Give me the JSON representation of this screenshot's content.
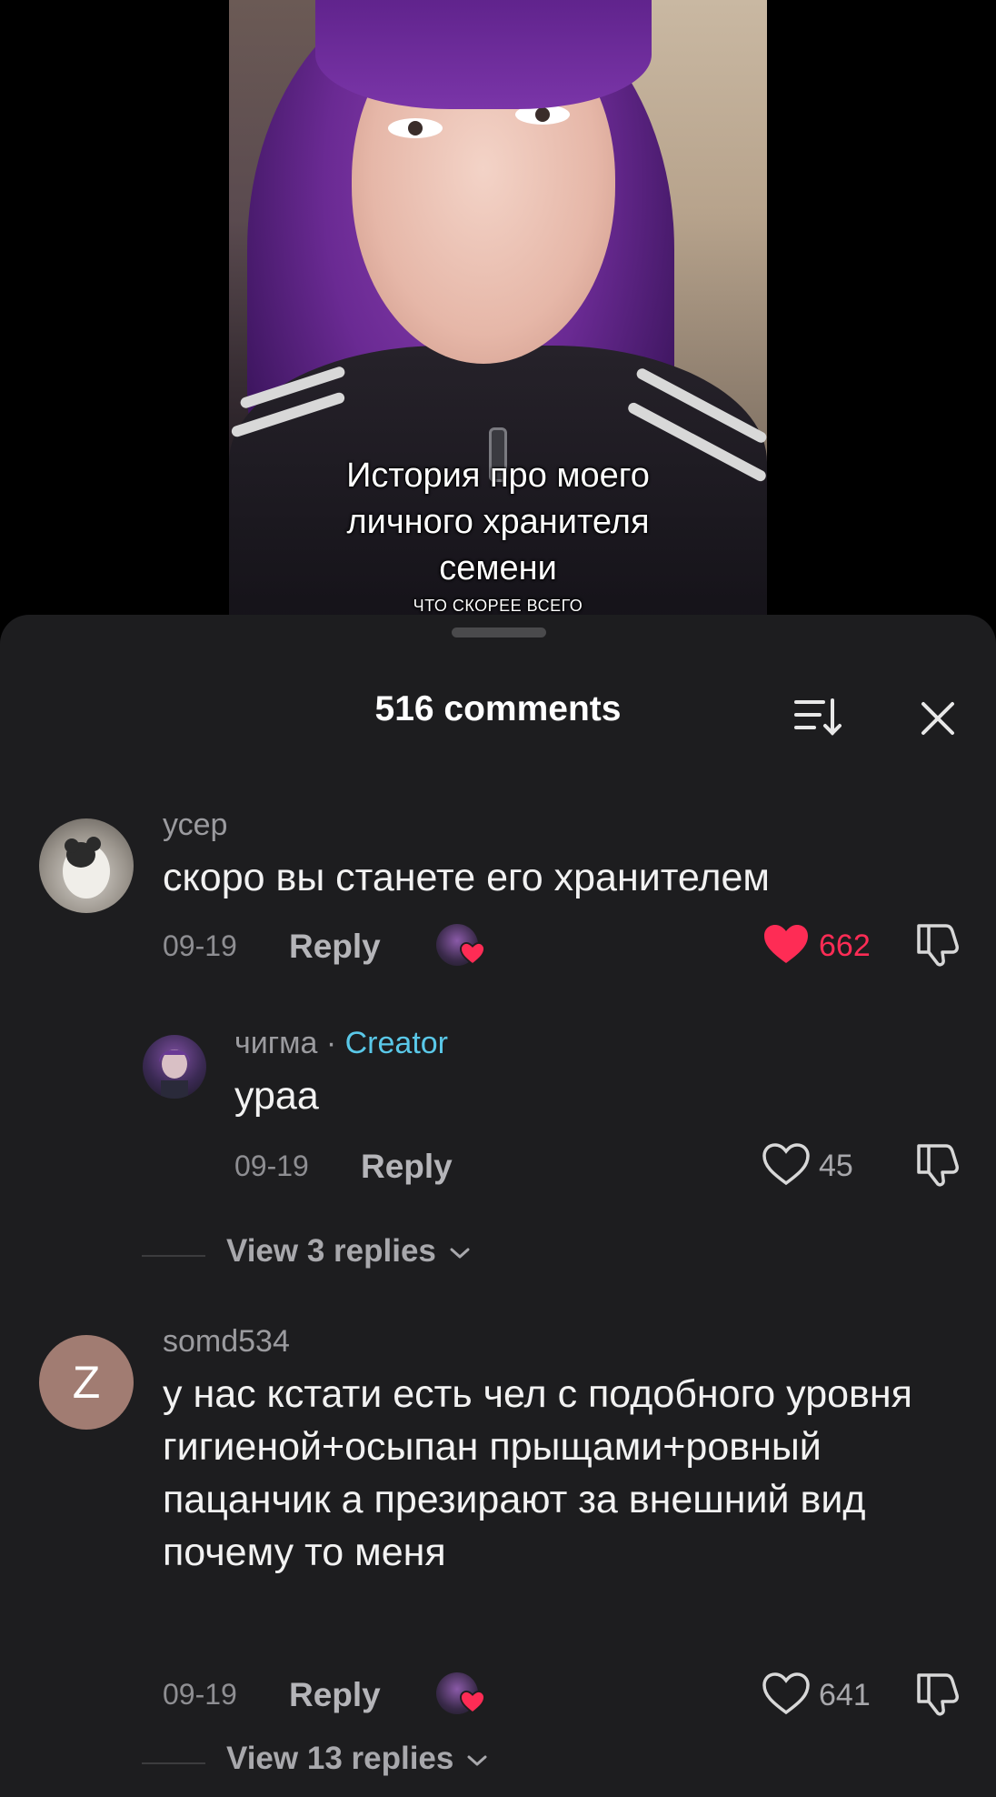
{
  "video": {
    "caption_main": "История про моего личного хранителя семени",
    "caption_sub": "ЧТО СКОРЕЕ ВСЕГО"
  },
  "header": {
    "title": "516 comments",
    "sort_icon": "sort-icon",
    "close_icon": "close-icon"
  },
  "comments": [
    {
      "username": "усер",
      "text": "скоро вы станете его хранителем",
      "date": "09-19",
      "reply_label": "Reply",
      "likes": "662",
      "liked": true,
      "like_color": "#fe2c55"
    },
    {
      "username": "чигма",
      "separator": " · ",
      "badge": "Creator",
      "text": "ураа",
      "date": "09-19",
      "reply_label": "Reply",
      "likes": "45",
      "liked": false
    },
    {
      "username": "somd534",
      "avatar_letter": "Z",
      "text": "у нас кстати есть чел с подобного уровня гигиеной+осыпан прыщами+ровный пацанчик а презирают за внешний вид почему то меня",
      "date": "09-19",
      "reply_label": "Reply",
      "likes": "641",
      "liked": false
    }
  ],
  "view_replies": [
    "View 3 replies",
    "View 13 replies"
  ],
  "colors": {
    "sheet_bg": "#1d1d1f",
    "creator_badge": "#5ac8e8",
    "heart_active": "#fe2c55"
  }
}
